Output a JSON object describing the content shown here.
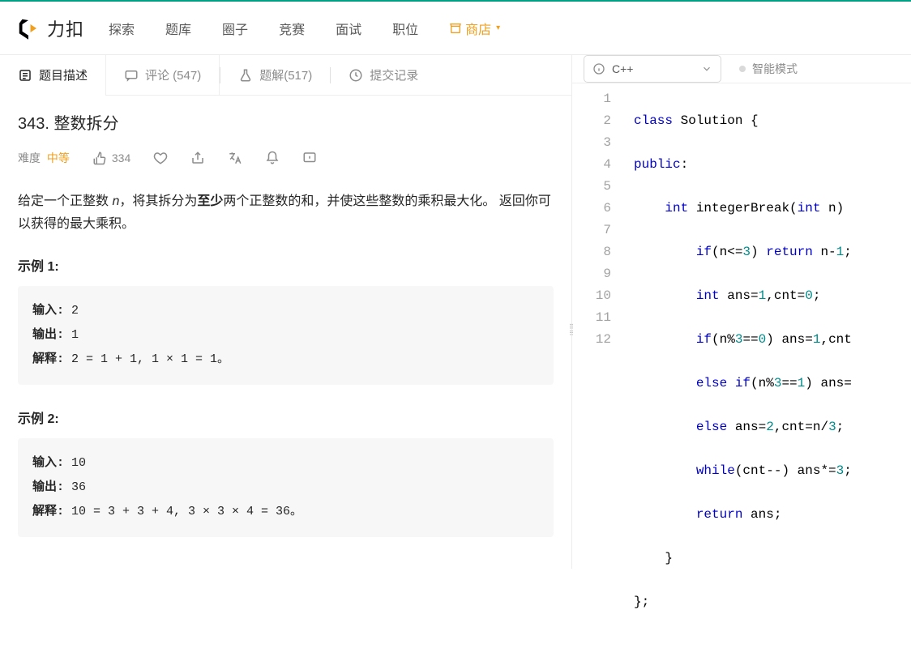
{
  "brand": "力扣",
  "nav": [
    "探索",
    "题库",
    "圈子",
    "竞赛",
    "面试",
    "职位"
  ],
  "shop_label": "商店",
  "problem_tabs": {
    "description": "题目描述",
    "comments": "评论 (547)",
    "solutions": "题解(517)",
    "submissions": "提交记录"
  },
  "problem": {
    "title": "343. 整数拆分",
    "difficulty_label": "难度",
    "difficulty_value": "中等",
    "likes": "334",
    "desc_parts": {
      "p1a": "给定一个正整数 ",
      "p1_em": "n",
      "p1b": "，将其拆分为",
      "bold": "至少",
      "p1c": "两个正整数的和，并使这些整数的乘积最大化。 返回你可以获得的最大乘积。"
    },
    "example1_title": "示例 1:",
    "example1": {
      "in_label": "输入: ",
      "in": "2",
      "out_label": "输出: ",
      "out": "1",
      "exp_label": "解释: ",
      "exp": "2 = 1 + 1, 1 × 1 = 1。"
    },
    "example2_title": "示例 2:",
    "example2": {
      "in_label": "输入: ",
      "in": "10",
      "out_label": "输出: ",
      "out": "36",
      "exp_label": "解释: ",
      "exp": "10 = 3 + 3 + 4, 3 × 3 × 4 = 36。"
    }
  },
  "editor": {
    "language": "C++",
    "mode": "智能模式",
    "line_numbers": [
      "1",
      "2",
      "3",
      "4",
      "5",
      "6",
      "7",
      "8",
      "9",
      "10",
      "11",
      "12"
    ],
    "code": {
      "l1": {
        "a": "class",
        "b": " Solution {"
      },
      "l2": {
        "a": "public",
        "b": ":"
      },
      "l3": {
        "a": "    ",
        "b": "int",
        "c": " integerBreak(",
        "d": "int",
        "e": " n) "
      },
      "l4": {
        "a": "        ",
        "b": "if",
        "c": "(n<=",
        "d": "3",
        "e": ") ",
        "f": "return",
        "g": " n-",
        "h": "1",
        ";": ";"
      },
      "l5": {
        "a": "        ",
        "b": "int",
        "c": " ans=",
        "d": "1",
        "e": ",cnt=",
        "f": "0",
        "g": ";"
      },
      "l6": {
        "a": "        ",
        "b": "if",
        "c": "(n%",
        "d": "3",
        "e": "==",
        "f": "0",
        "g": ") ans=",
        "h": "1",
        "i": ",cnt"
      },
      "l7": {
        "a": "        ",
        "b": "else",
        "c": " ",
        "d": "if",
        "e": "(n%",
        "f": "3",
        "g": "==",
        "h": "1",
        "i": ") ans="
      },
      "l8": {
        "a": "        ",
        "b": "else",
        "c": " ans=",
        "d": "2",
        "e": ",cnt=n/",
        "f": "3",
        "g": ";"
      },
      "l9": {
        "a": "        ",
        "b": "while",
        "c": "(cnt--) ans*=",
        "d": "3",
        ";": ";"
      },
      "l10": {
        "a": "        ",
        "b": "return",
        "c": " ans;"
      },
      "l11": "    }",
      "l12": "};"
    }
  }
}
